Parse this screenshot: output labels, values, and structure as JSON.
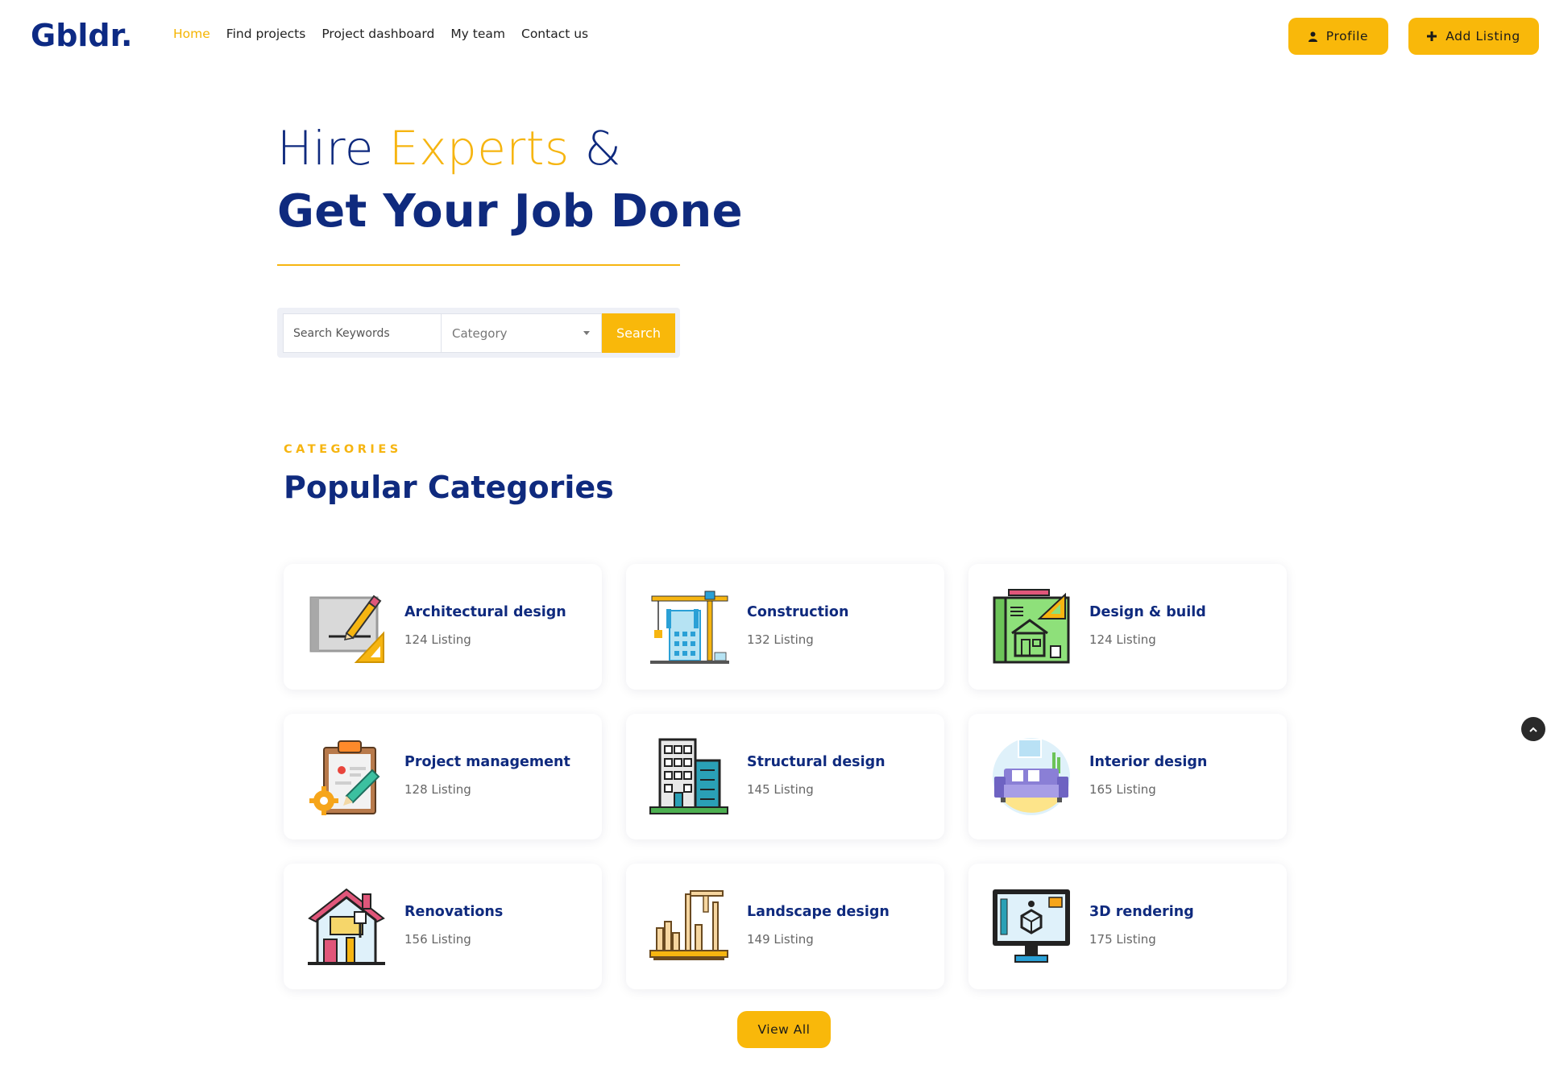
{
  "header": {
    "logo": "Gbldr.",
    "nav": [
      {
        "label": "Home",
        "active": true
      },
      {
        "label": "Find projects",
        "active": false
      },
      {
        "label": "Project dashboard",
        "active": false
      },
      {
        "label": "My team",
        "active": false
      },
      {
        "label": "Contact us",
        "active": false
      }
    ],
    "profile_label": "Profile",
    "add_listing_label": "Add Listing"
  },
  "hero": {
    "line1_a": "Hire ",
    "line1_accent": "Experts",
    "line1_b": " &",
    "line2": "Get Your Job Done"
  },
  "search": {
    "placeholder": "Search Keywords",
    "category_value": "Category",
    "button_label": "Search"
  },
  "categories": {
    "eyebrow": "CATEGORIES",
    "title": "Popular Categories",
    "items": [
      {
        "name": "Architectural design",
        "count": "124 Listing",
        "icon": "blueprint-pencil-icon"
      },
      {
        "name": "Construction",
        "count": "132 Listing",
        "icon": "crane-building-icon"
      },
      {
        "name": "Design & build",
        "count": "124 Listing",
        "icon": "house-plan-icon"
      },
      {
        "name": "Project management",
        "count": "128 Listing",
        "icon": "clipboard-gear-icon"
      },
      {
        "name": "Structural design",
        "count": "145 Listing",
        "icon": "office-building-icon"
      },
      {
        "name": "Interior design",
        "count": "165 Listing",
        "icon": "sofa-icon"
      },
      {
        "name": "Renovations",
        "count": "156 Listing",
        "icon": "house-paint-roller-icon"
      },
      {
        "name": "Landscape design",
        "count": "149 Listing",
        "icon": "city-skyline-icon"
      },
      {
        "name": "3D rendering",
        "count": "175 Listing",
        "icon": "monitor-3d-cube-icon"
      }
    ],
    "view_all_label": "View All"
  },
  "colors": {
    "brand_navy": "#0f2a7e",
    "accent_yellow": "#f9b80a"
  }
}
